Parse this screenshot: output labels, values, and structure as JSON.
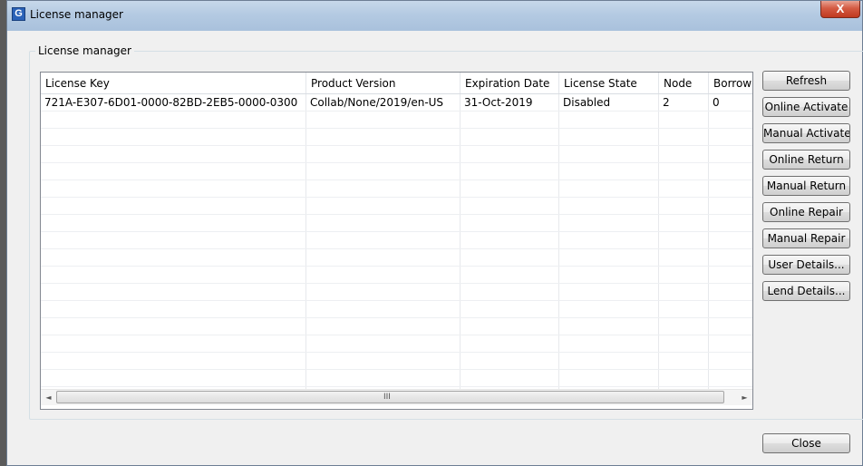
{
  "window": {
    "title": "License manager",
    "icon": "app-g-icon",
    "icon_glyph": "G",
    "close_glyph": "X"
  },
  "group": {
    "label": "License manager"
  },
  "table": {
    "columns": [
      "License Key",
      "Product Version",
      "Expiration Date",
      "License State",
      "Node",
      "Borrow"
    ],
    "rows": [
      [
        "721A-E307-6D01-0000-82BD-2EB5-0000-0300",
        "Collab/None/2019/en-US",
        "31-Oct-2019",
        "Disabled",
        "2",
        "0"
      ]
    ],
    "scrollbar": {
      "left_arrow": "◄",
      "right_arrow": "►",
      "grip": "III"
    }
  },
  "buttons": {
    "refresh": "Refresh",
    "online_activate": "Online Activate",
    "manual_activate": "Manual Activate",
    "online_return": "Online Return",
    "manual_return": "Manual Return",
    "online_repair": "Online Repair",
    "manual_repair": "Manual Repair",
    "user_details": "User Details...",
    "lend_details": "Lend Details...",
    "close": "Close"
  }
}
